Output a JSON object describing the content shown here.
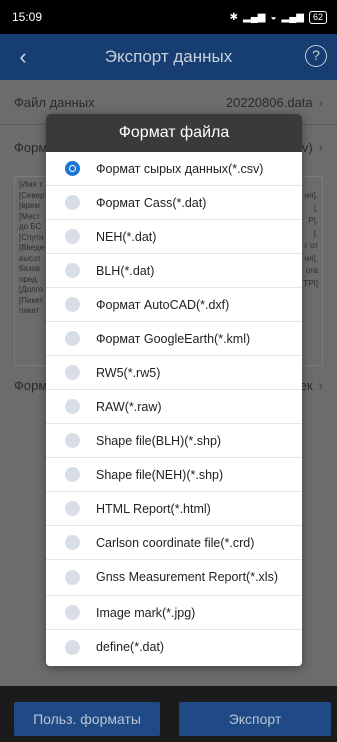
{
  "status": {
    "time": "15:09",
    "battery": "62"
  },
  "header": {
    "title": "Экспорт данных"
  },
  "background": {
    "data_file_label": "Файл данных",
    "data_file_value": "20220806.data",
    "format_label_partial": "Форм",
    "format_value_partial": "sv)",
    "format2_label_partial": "Форм",
    "format2_value_partial": "Сек",
    "fields_text_left": "[Имя т\n[Север\n[врем\n[Мест\nдо БС\n[Спутн\n[Введе\nвысот\nбазов\nпред.\n[Долго\n[Пикет\nпикет",
    "fields_text_right": "ия],\n],\nP],\n],\nг от\nия],\nота\nTPI]"
  },
  "dialog": {
    "title": "Формат файла",
    "selected_index": 0,
    "options": [
      "Формат сырых данных(*.csv)",
      "Формат Cass(*.dat)",
      "NEH(*.dat)",
      "BLH(*.dat)",
      "Формат AutoCAD(*.dxf)",
      "Формат GoogleEarth(*.kml)",
      "RW5(*.rw5)",
      "RAW(*.raw)",
      "Shape file(BLH)(*.shp)",
      "Shape file(NEH)(*.shp)",
      "HTML Report(*.html)",
      "Carlson coordinate file(*.crd)",
      "Gnss Measurement Report(*.xls)",
      "Image mark(*.jpg)",
      "define(*.dat)"
    ]
  },
  "buttons": {
    "custom_formats": "Польз. форматы",
    "export": "Экспорт"
  },
  "colors": {
    "accent": "#1976d2",
    "header": "#163e73",
    "button": "#1f4a85"
  }
}
